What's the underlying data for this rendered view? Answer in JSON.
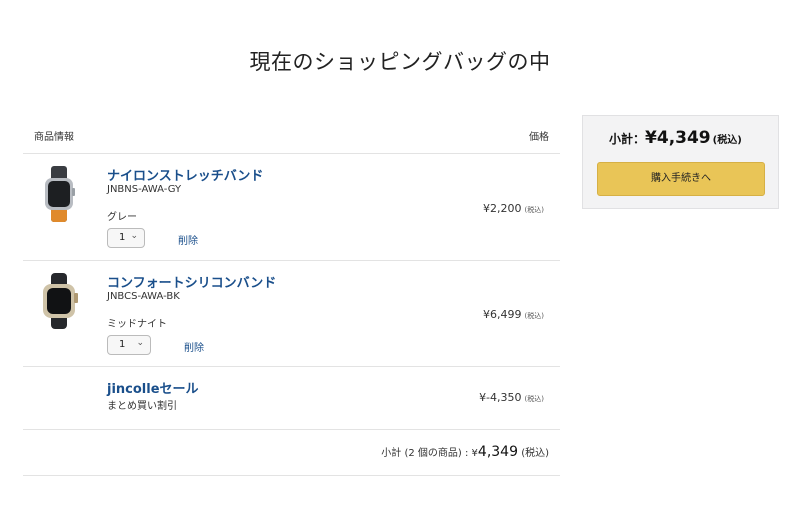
{
  "page": {
    "title": "現在のショッピングバッグの中"
  },
  "cart": {
    "header": {
      "item_label": "商品情報",
      "price_label": "価格"
    },
    "items": [
      {
        "name": "ナイロンストレッチバンド",
        "sku": "JNBNS-AWA-GY",
        "variant": "グレー",
        "quantity": "1",
        "delete_label": "削除",
        "price": "¥2,200",
        "tax_note": "(税込)"
      },
      {
        "name": "コンフォートシリコンバンド",
        "sku": "JNBCS-AWA-BK",
        "variant": "ミッドナイト",
        "quantity": "1",
        "delete_label": "削除",
        "price": "¥6,499",
        "tax_note": "(税込)"
      }
    ],
    "discount": {
      "name": "jincolleセール",
      "description": "まとめ買い割引",
      "price": "¥-4,350",
      "tax_note": "(税込)"
    },
    "subtotal": {
      "label": "小計 (2 個の商品) : ",
      "currency": "¥",
      "amount": "4,349",
      "tax_note": " (税込)"
    }
  },
  "summary": {
    "label": "小計：",
    "currency": "¥",
    "amount": "4,349",
    "tax_note": "(税込)",
    "checkout_label": "購入手続きへ"
  },
  "colors": {
    "link": "#1a4f8b",
    "checkout_button": "#e9c557",
    "summary_bg": "#f3f3f4"
  },
  "icons": {
    "qty_dropdown": "chevron-down-icon"
  }
}
